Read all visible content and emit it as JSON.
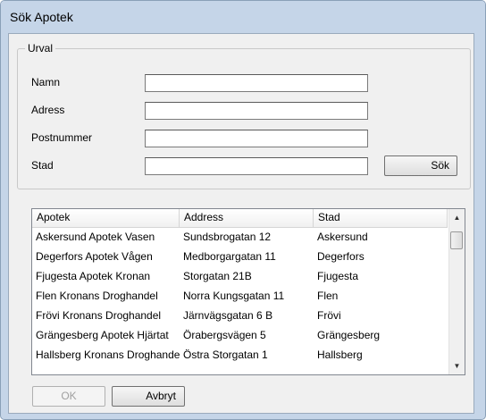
{
  "window": {
    "title": "Sök Apotek"
  },
  "filter": {
    "legend": "Urval",
    "fields": [
      {
        "label": "Namn",
        "value": ""
      },
      {
        "label": "Adress",
        "value": ""
      },
      {
        "label": "Postnummer",
        "value": ""
      },
      {
        "label": "Stad",
        "value": ""
      }
    ],
    "search_label": "Sök"
  },
  "list": {
    "columns": [
      "Apotek",
      "Address",
      "Stad"
    ],
    "rows": [
      [
        "Askersund Apotek Vasen",
        "Sundsbrogatan 12",
        "Askersund"
      ],
      [
        "Degerfors Apotek Vågen",
        "Medborgargatan 11",
        "Degerfors"
      ],
      [
        "Fjugesta Apotek Kronan",
        "Storgatan 21B",
        "Fjugesta"
      ],
      [
        "Flen Kronans Droghandel",
        "Norra Kungsgatan 11",
        "Flen"
      ],
      [
        "Frövi Kronans Droghandel",
        "Järnvägsgatan 6 B",
        "Frövi"
      ],
      [
        "Grängesberg Apotek Hjärtat",
        "Örabergsvägen 5",
        "Grängesberg"
      ],
      [
        "Hallsberg Kronans Droghandel",
        "Östra Storgatan 1",
        "Hallsberg"
      ]
    ],
    "scroll_up_icon": "scroll-up-arrow",
    "scroll_down_icon": "scroll-down-arrow"
  },
  "buttons": {
    "ok": "OK",
    "cancel": "Avbryt"
  }
}
